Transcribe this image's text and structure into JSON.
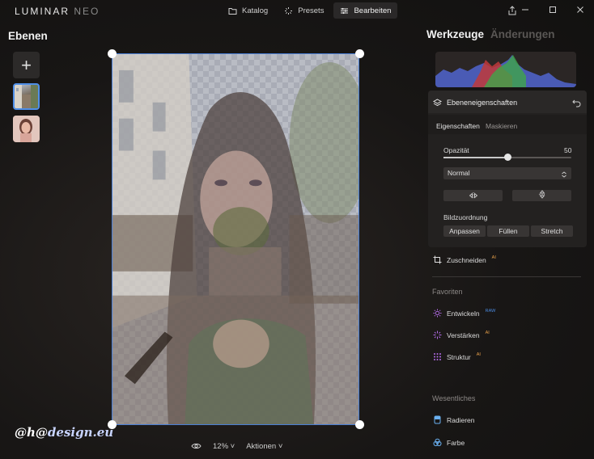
{
  "app": {
    "logo_main": "LUMINAR",
    "logo_neo": "NEO"
  },
  "nav": {
    "catalog": "Katalog",
    "presets": "Presets",
    "edit": "Bearbeiten"
  },
  "left_panel": {
    "title": "Ebenen",
    "add_symbol": "+"
  },
  "canvas": {
    "zoom": "12%",
    "actions": "Aktionen"
  },
  "watermark": {
    "prefix": "@h@",
    "suffix": "design.eu"
  },
  "right_panel": {
    "tools_title": "Werkzeuge",
    "changes_title": "Änderungen",
    "layer_props": {
      "title": "Ebeneneigenschaften",
      "tab_properties": "Eigenschaften",
      "tab_mask": "Maskieren",
      "opacity_label": "Opazität",
      "opacity_value": "50",
      "opacity": 50,
      "blend_mode": "Normal",
      "image_fit_label": "Bildzuordnung",
      "fit_buttons": [
        "Anpassen",
        "Füllen",
        "Stretch"
      ]
    },
    "crop": {
      "label": "Zuschneiden",
      "badge": "AI"
    },
    "favorites": {
      "title": "Favoriten",
      "items": [
        {
          "label": "Entwickeln",
          "badge": "RAW",
          "icon": "sun-icon"
        },
        {
          "label": "Verstärken",
          "badge": "AI",
          "icon": "sparkle-icon"
        },
        {
          "label": "Struktur",
          "badge": "AI",
          "icon": "structure-icon"
        }
      ]
    },
    "essentials": {
      "title": "Wesentliches",
      "items": [
        {
          "label": "Radieren",
          "icon": "eraser-icon"
        },
        {
          "label": "Farbe",
          "icon": "color-icon"
        }
      ]
    }
  },
  "colors": {
    "accent_blue": "#4f8fe8",
    "ai_badge": "#e8a04a",
    "raw_badge": "#4a8ae0",
    "tool_purple": "#b36be8"
  }
}
